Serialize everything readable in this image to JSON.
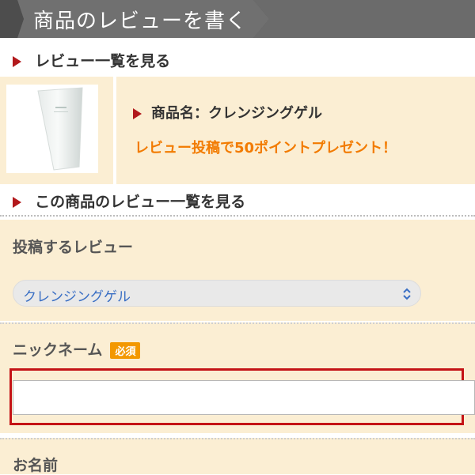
{
  "header": {
    "title": "商品のレビューを書く"
  },
  "links": {
    "review_list": "レビュー一覧を見る",
    "this_product_reviews": "この商品のレビュー一覧を見る"
  },
  "product": {
    "name": "商品名：クレンジングゲル",
    "promo": "レビュー投稿で50ポイントプレゼント！"
  },
  "form": {
    "post_review_label": "投稿するレビュー",
    "product_select_value": "クレンジングゲル",
    "nickname_label": "ニックネーム",
    "required_badge": "必須",
    "nickname_value": "",
    "name_label": "お名前"
  },
  "colors": {
    "accent_red": "#b2191c",
    "promo_orange": "#f27b00",
    "section_bg": "#fbeed3",
    "highlight_border": "#c41316",
    "required_badge_bg": "#f39800"
  },
  "icons": {
    "bullet": "triangle-right-icon",
    "select": "updown-arrows-icon"
  }
}
